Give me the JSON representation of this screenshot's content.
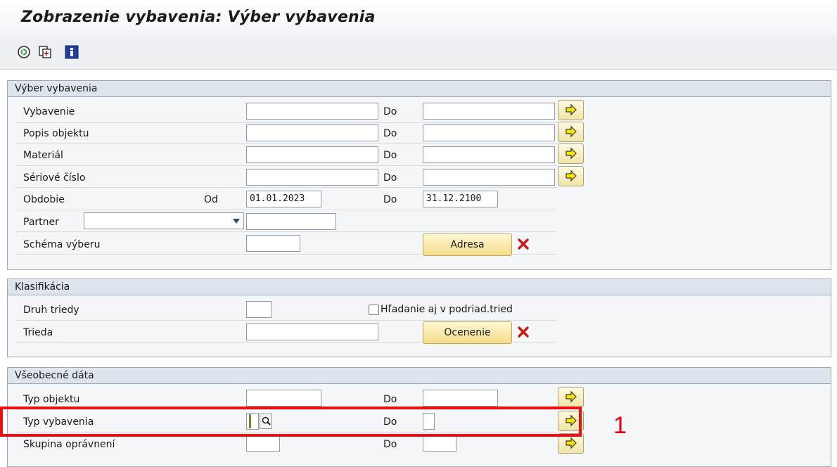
{
  "window": {
    "title": "Zobrazenie vybavenia: Výber vybavenia"
  },
  "toolbar": {
    "icons": [
      "execute-icon",
      "get-variant-icon",
      "info-icon"
    ]
  },
  "groups": {
    "vyber": {
      "header": "Výber vybavenia",
      "rows": {
        "vybavenie": {
          "label": "Vybavenie",
          "from": "",
          "to_label": "Do",
          "to": ""
        },
        "popis": {
          "label": "Popis objektu",
          "from": "",
          "to_label": "Do",
          "to": ""
        },
        "material": {
          "label": "Materiál",
          "from": "",
          "to_label": "Do",
          "to": ""
        },
        "seriove": {
          "label": "Sériové číslo",
          "from": "",
          "to_label": "Do",
          "to": ""
        },
        "obdobie": {
          "label": "Obdobie",
          "od_label": "Od",
          "from": "01.01.2023",
          "to_label": "Do",
          "to": "31.12.2100"
        },
        "partner": {
          "label": "Partner",
          "role": "",
          "value": ""
        },
        "schema": {
          "label": "Schéma výberu",
          "value": "",
          "button": "Adresa"
        }
      }
    },
    "klasifikacia": {
      "header": "Klasifikácia",
      "rows": {
        "druh": {
          "label": "Druh triedy",
          "value": "",
          "checkbox_label": "Hľadanie aj v podriad.tried"
        },
        "trieda": {
          "label": "Trieda",
          "value": "",
          "button": "Ocenenie"
        }
      }
    },
    "vseobecne": {
      "header": "Všeobecné dáta",
      "rows": {
        "typ_objektu": {
          "label": "Typ objektu",
          "from": "",
          "to_label": "Do",
          "to": ""
        },
        "typ_vybavenia": {
          "label": "Typ vybavenia",
          "from": "",
          "to_label": "Do",
          "to": ""
        },
        "skupina": {
          "label": "Skupina oprávnení",
          "from": "",
          "to_label": "Do",
          "to": ""
        }
      }
    }
  },
  "annotation": {
    "number": "1",
    "color": "#e3000f"
  },
  "colors": {
    "highlight": "#ee1010",
    "group_header_bg": "#dde4ec",
    "button_bg": "#f6dc88"
  }
}
